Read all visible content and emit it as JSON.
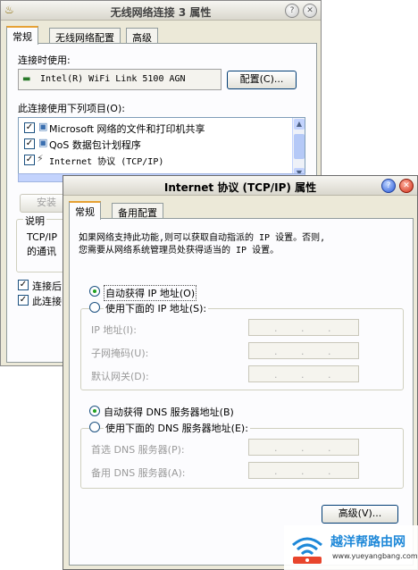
{
  "window1": {
    "title": "无线网络连接 3 属性",
    "tabs": [
      "常规",
      "无线网络配置",
      "高级"
    ],
    "connect_using_label": "连接时使用:",
    "adapter_name": "Intel(R) WiFi Link 5100 AGN",
    "configure_button": "配置(C)...",
    "items_label": "此连接使用下列项目(O):",
    "items": [
      {
        "label": "Microsoft 网络的文件和打印机共享",
        "checked": true
      },
      {
        "label": "QoS 数据包计划程序",
        "checked": true
      },
      {
        "label": "Internet 协议 (TCP/IP)",
        "checked": true
      }
    ],
    "install_button": "安装",
    "description_label": "说明",
    "description_text_1": "TCP/IP",
    "description_text_2": "的通讯",
    "check1_label": "连接后",
    "check2_label": "此连接"
  },
  "window2": {
    "title": "Internet 协议 (TCP/IP) 属性",
    "tabs": [
      "常规",
      "备用配置"
    ],
    "intro_line1": "如果网络支持此功能,则可以获取自动指派的 IP 设置。否则,",
    "intro_line2": "您需要从网络系统管理员处获得适当的 IP 设置。",
    "auto_ip": "自动获得 IP 地址(O)",
    "manual_ip": "使用下面的 IP 地址(S):",
    "ip_address": "IP 地址(I):",
    "subnet_mask": "子网掩码(U):",
    "gateway": "默认网关(D):",
    "auto_dns": "自动获得 DNS 服务器地址(B)",
    "manual_dns": "使用下面的 DNS 服务器地址(E):",
    "preferred_dns": "首选 DNS 服务器(P):",
    "alternate_dns": "备用 DNS 服务器(A):",
    "advanced_button": "高级(V)...",
    "ip_dot": "."
  },
  "watermark": {
    "brand": "越洋帮路由网",
    "url": "www.yueyangbang.com"
  }
}
